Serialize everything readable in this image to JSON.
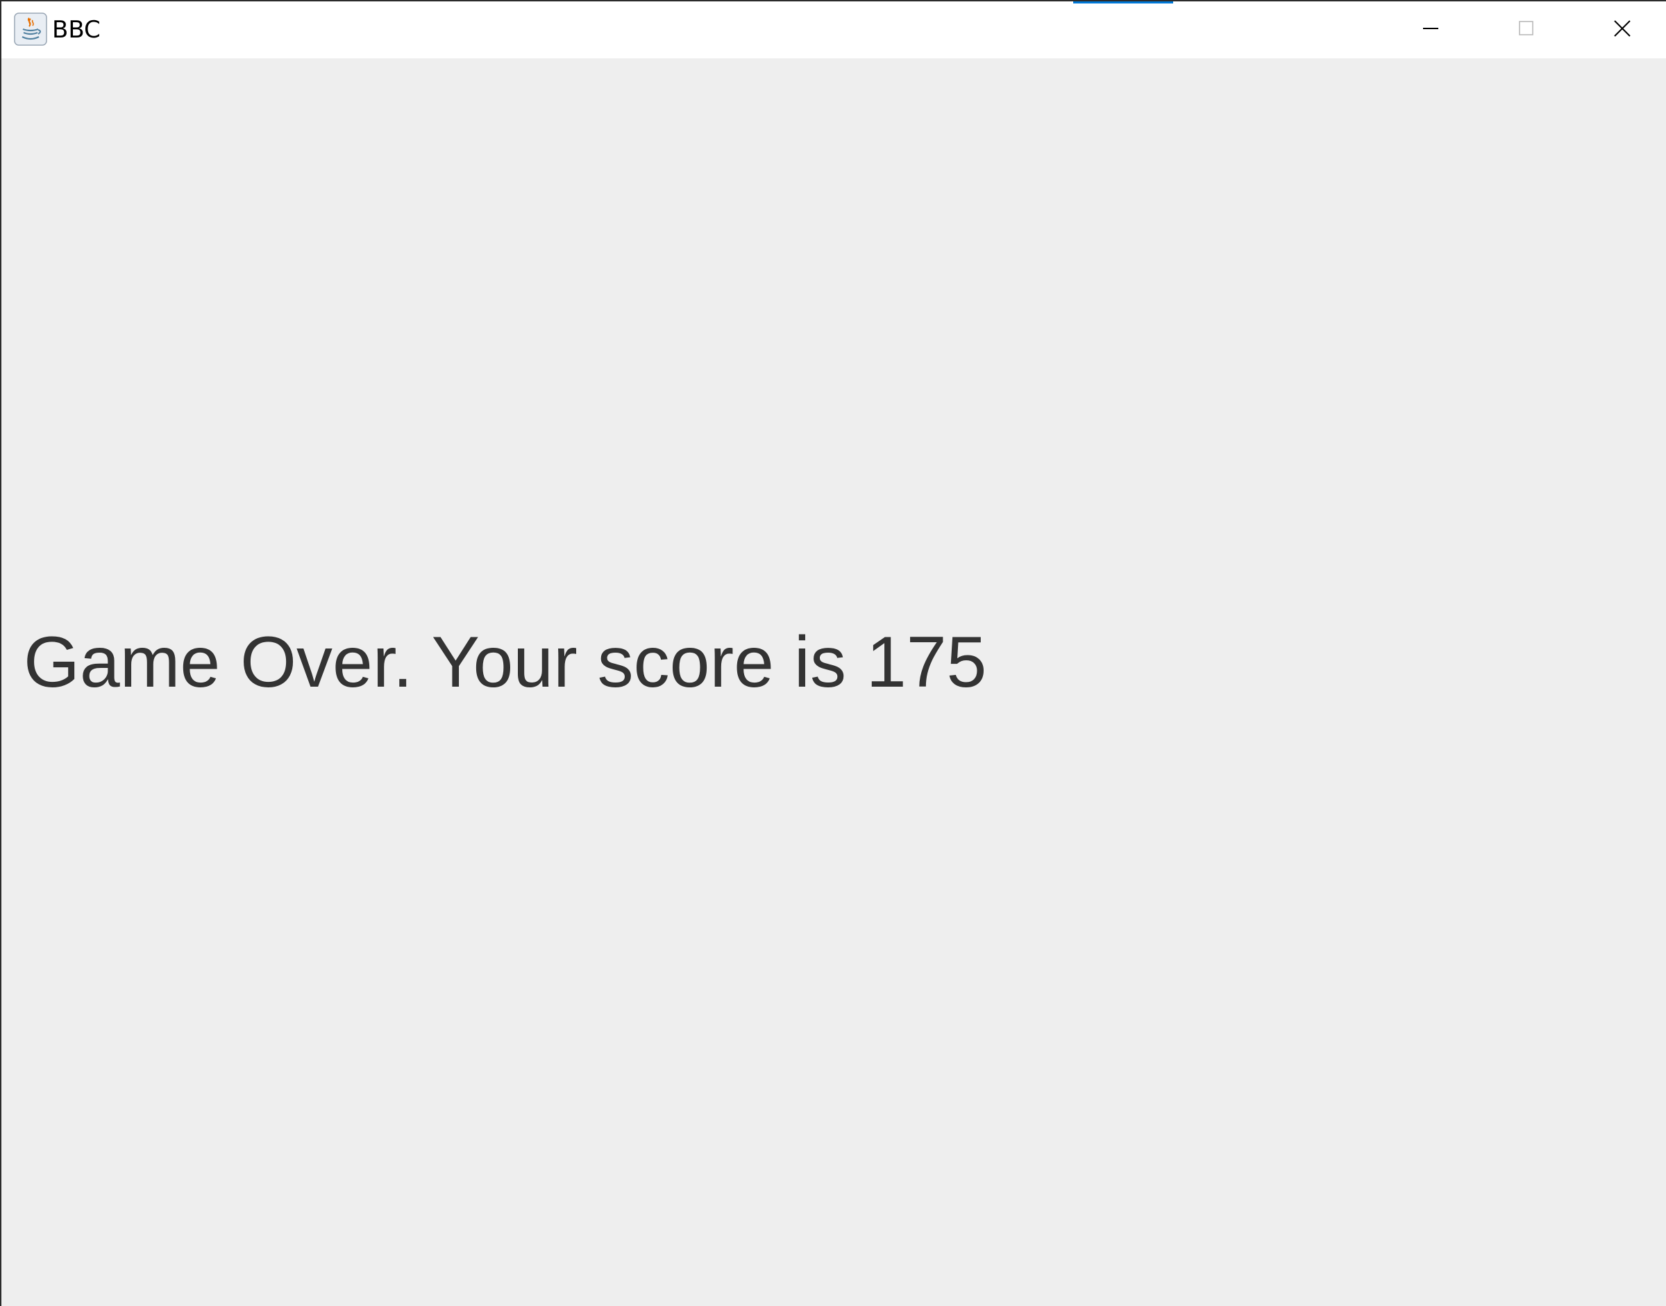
{
  "window": {
    "title": "BBC",
    "icon": "java-cup-icon",
    "controls": {
      "minimize": "minimize-icon",
      "maximize": "maximize-icon",
      "close": "close-icon"
    },
    "accent_color": "#0078d7"
  },
  "content": {
    "message": "Game Over. Your score is 175",
    "text_color": "#333333",
    "background_color": "#eeeeee"
  }
}
